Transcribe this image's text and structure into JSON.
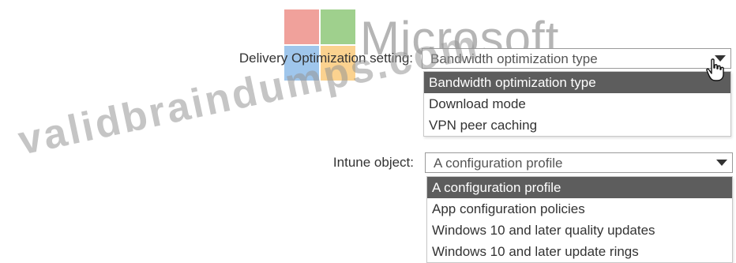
{
  "watermark_logo": {
    "text": "Microsoft"
  },
  "watermark_site": {
    "text": "validbraindumps.com"
  },
  "delivery": {
    "label": "Delivery Optimization setting:",
    "selected": "Bandwidth optimization type",
    "options": [
      "Bandwidth optimization type",
      "Download mode",
      "VPN peer caching"
    ]
  },
  "intune": {
    "label": "Intune object:",
    "selected": "A configuration profile",
    "options": [
      "A configuration profile",
      "App configuration policies",
      "Windows 10 and later quality updates",
      "Windows 10 and later update rings"
    ]
  },
  "icons": {
    "dropdown_arrow": "chevron-down-icon",
    "cursor": "hand-cursor-icon"
  }
}
